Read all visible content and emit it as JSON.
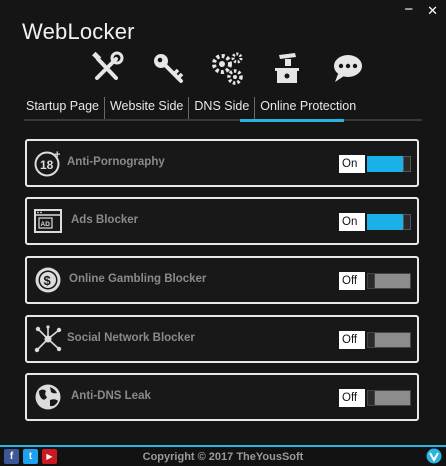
{
  "window": {
    "title": "WebLocker",
    "minimize_glyph": "−",
    "close_glyph": "✕"
  },
  "toolbar": [
    {
      "icon": "tools-icon"
    },
    {
      "icon": "key-icon"
    },
    {
      "icon": "gears-icon"
    },
    {
      "icon": "ballot-box-icon"
    },
    {
      "icon": "chat-bubble-icon"
    }
  ],
  "tabs": [
    {
      "label": "Startup Page",
      "active": false
    },
    {
      "label": "Website Side",
      "active": false
    },
    {
      "label": "DNS Side",
      "active": false
    },
    {
      "label": "Online Protection",
      "active": true
    }
  ],
  "features": [
    {
      "icon": "age-18-plus-icon",
      "label": "Anti-Pornography",
      "state": "On",
      "enabled": true
    },
    {
      "icon": "ad-block-icon",
      "label": "Ads Blocker",
      "state": "On",
      "enabled": true
    },
    {
      "icon": "dollar-coin-icon",
      "label": "Online Gambling Blocker",
      "state": "Off",
      "enabled": false
    },
    {
      "icon": "network-nodes-icon",
      "label": "Social Network Blocker",
      "state": "Off",
      "enabled": false
    },
    {
      "icon": "globe-icon",
      "label": "Anti-DNS Leak",
      "state": "Off",
      "enabled": false
    }
  ],
  "footer": {
    "copyright": "Copyright © 2017 TheYousSoft",
    "social": [
      {
        "icon": "facebook-icon",
        "glyph": "f",
        "color": "#3b5998"
      },
      {
        "icon": "twitter-icon",
        "glyph": "t",
        "color": "#1da1f2"
      },
      {
        "icon": "youtube-icon",
        "glyph": "▶",
        "color": "#cc181e"
      }
    ]
  },
  "colors": {
    "accent": "#2bb3e3",
    "toggle_on": "#1ab0e8",
    "toggle_off": "#8c8c8c",
    "card_border": "#e8e8e8"
  }
}
